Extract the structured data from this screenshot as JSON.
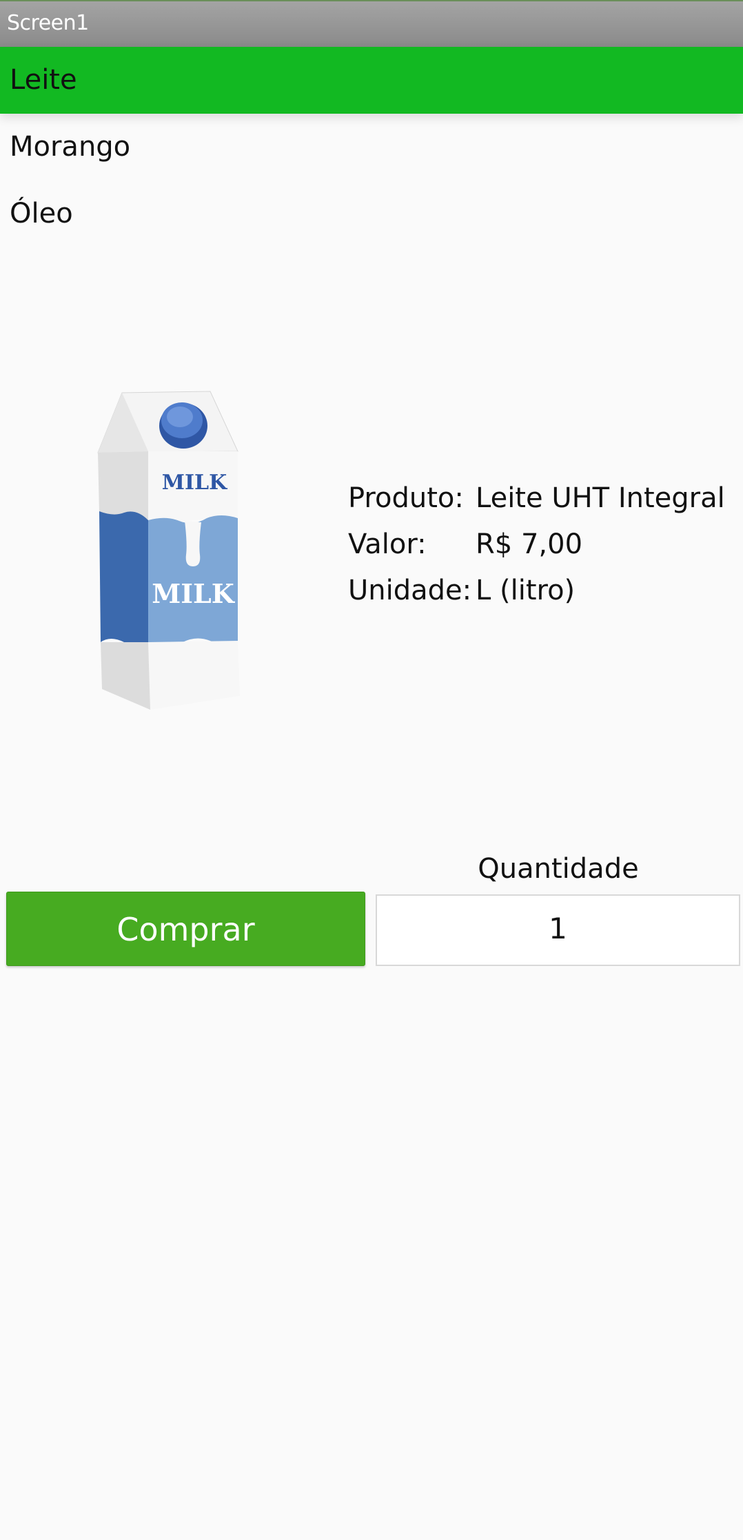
{
  "window": {
    "title": "Screen1"
  },
  "products_list": [
    {
      "label": "Leite",
      "selected": true
    },
    {
      "label": "Morango",
      "selected": false
    },
    {
      "label": "Óleo",
      "selected": false
    }
  ],
  "product_image": {
    "brand_text_top": "MILK",
    "brand_text_main": "MILK"
  },
  "product_info": {
    "product_label": "Produto:",
    "product_value": "Leite UHT Integral",
    "price_label": "Valor:",
    "price_value": "R$ 7,00",
    "unit_label": "Unidade:",
    "unit_value": "L (litro)"
  },
  "purchase": {
    "quantity_label": "Quantidade",
    "quantity_value": "1",
    "buy_label": "Comprar"
  },
  "colors": {
    "selected_item": "#12b922",
    "buy_button": "#47ab21",
    "titlebar": "#8a8a8a"
  }
}
